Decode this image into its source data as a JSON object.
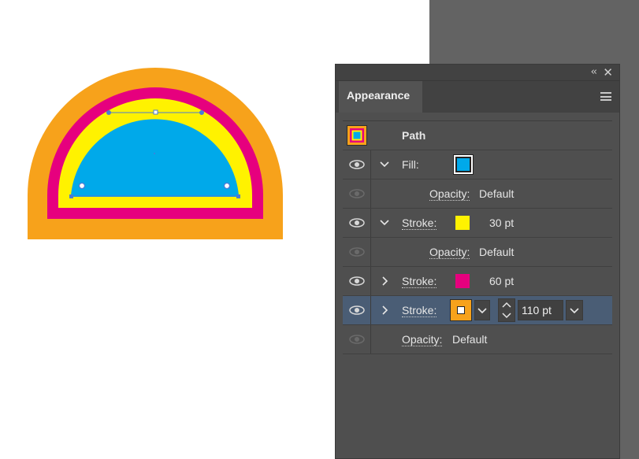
{
  "panel": {
    "tab_label": "Appearance",
    "collapse_glyph": "‹‹",
    "close_glyph": "✕"
  },
  "rows": {
    "path_label": "Path",
    "fill_label": "Fill:",
    "fill_opacity_label": "Opacity:",
    "fill_opacity_value": "Default",
    "stroke1_label": "Stroke:",
    "stroke1_weight": "30 pt",
    "stroke1_opacity_label": "Opacity:",
    "stroke1_opacity_value": "Default",
    "stroke2_label": "Stroke:",
    "stroke2_weight": "60 pt",
    "stroke3_label": "Stroke:",
    "stroke3_weight": "110 pt",
    "object_opacity_label": "Opacity:",
    "object_opacity_value": "Default"
  },
  "colors": {
    "fill": "#00a9ea",
    "stroke_yellow": "#fff200",
    "stroke_magenta": "#e6007e",
    "stroke_orange": "#f7a21b",
    "selection_row": "#4a5d75"
  },
  "icons": [
    "eye-icon",
    "chevron-down-icon",
    "chevron-right-icon",
    "menu-icon",
    "close-icon",
    "collapse-icon"
  ]
}
